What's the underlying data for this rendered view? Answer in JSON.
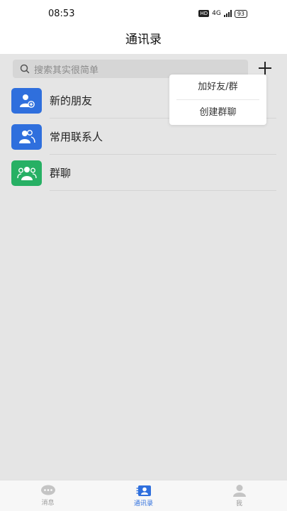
{
  "status_bar": {
    "time": "08:53",
    "hd": "HD",
    "network": "4G",
    "battery": "93"
  },
  "header": {
    "title": "通讯录"
  },
  "search": {
    "placeholder": "搜索其实很简单"
  },
  "contacts": [
    {
      "label": "新的朋友",
      "icon": "add-friend-icon",
      "color": "#2f6fdd"
    },
    {
      "label": "常用联系人",
      "icon": "frequent-contacts-icon",
      "color": "#2f6fdd"
    },
    {
      "label": "群聊",
      "icon": "group-chat-icon",
      "color": "#27b064"
    }
  ],
  "popup_menu": {
    "items": [
      "加好友/群",
      "创建群聊"
    ]
  },
  "tabbar": {
    "tabs": [
      {
        "label": "消息",
        "icon": "message-icon",
        "active": false
      },
      {
        "label": "通讯录",
        "icon": "contacts-icon",
        "active": true
      },
      {
        "label": "我",
        "icon": "profile-icon",
        "active": false
      }
    ]
  },
  "colors": {
    "accent": "#2f6fdd",
    "green": "#27b064",
    "background": "#e5e5e5"
  }
}
